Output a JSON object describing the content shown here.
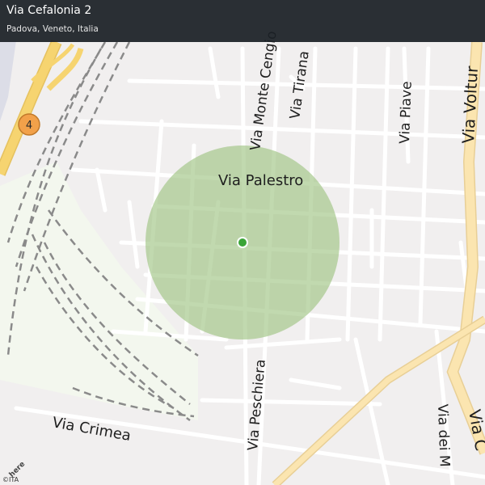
{
  "location": {
    "title": "Via Cefalonia 2",
    "subtitle": "Padova, Veneto, Italia"
  },
  "streets": {
    "via_palestro": "Via  Palestro",
    "via_monte_cengio": "Via Monte Cengio",
    "via_tirana": "Via  Tirana",
    "via_piave": "Via  Piave",
    "via_volturno": "Via  Voltur",
    "via_peschiera": "Via  Peschiera",
    "via_crimea": "Via  Crimea",
    "via_dei_m": "Via dei M",
    "via_c": "Via  C"
  },
  "road_shield": "4",
  "attribution": {
    "copyright": "©ITA",
    "logo": "here"
  },
  "colors": {
    "radius_fill": "#9bc17e",
    "marker": "#3aa537",
    "highway": "#f6d470",
    "shield": "#f2a14a"
  }
}
